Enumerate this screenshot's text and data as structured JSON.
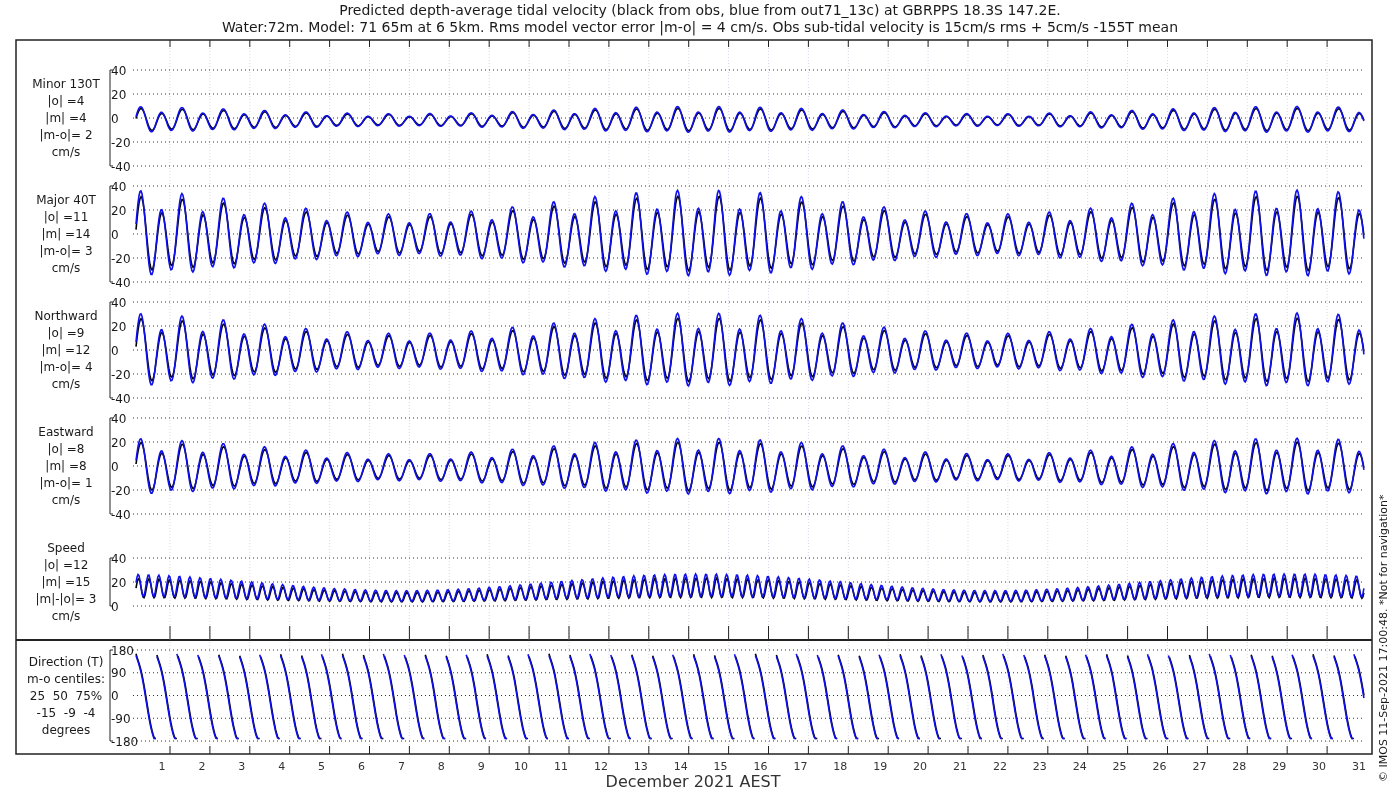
{
  "title": "Predicted depth-average tidal velocity (black from obs, blue from out71_13c) at GBRPPS 18.3S 147.2E.",
  "subtitle": "Water:72m. Model: 71 65m at 6 5km. Rms model vector error |m-o| = 4 cm/s. Obs sub-tidal velocity is 15cm/s rms + 5cm/s -155T mean",
  "panels": [
    {
      "kind": "velocity",
      "label": [
        "Minor 130T",
        "|o| =4",
        "|m| =4",
        "|m-o|= 2",
        "cm/s"
      ],
      "yticks": [
        "40",
        "20",
        "0",
        "-20",
        "-40"
      ]
    },
    {
      "kind": "velocity",
      "label": [
        "Major 40T",
        "|o| =11",
        "|m| =14",
        "|m-o|= 3",
        "cm/s"
      ],
      "yticks": [
        "40",
        "20",
        "0",
        "-20",
        "-40"
      ]
    },
    {
      "kind": "velocity",
      "label": [
        "Northward",
        "|o| =9",
        "|m| =12",
        "|m-o|= 4",
        "cm/s"
      ],
      "yticks": [
        "40",
        "20",
        "0",
        "-20",
        "-40"
      ]
    },
    {
      "kind": "velocity",
      "label": [
        "Eastward",
        "|o| =8",
        "|m| =8",
        "|m-o|= 1",
        "cm/s"
      ],
      "yticks": [
        "40",
        "20",
        "0",
        "-20",
        "-40"
      ]
    },
    {
      "kind": "speed",
      "label": [
        "Speed",
        "|o| =12",
        "|m| =15",
        "|m|-|o|= 3",
        "cm/s"
      ],
      "yticks": [
        "40",
        "20",
        "0"
      ]
    },
    {
      "kind": "direction",
      "label": [
        "Direction (T)",
        "m-o centiles:",
        "25  50  75%",
        "-15  -9  -4",
        "degrees"
      ],
      "yticks": [
        "180",
        "90",
        "0",
        "-90",
        "-180"
      ]
    }
  ],
  "xaxis": {
    "ticks": [
      "1",
      "2",
      "3",
      "4",
      "5",
      "6",
      "7",
      "8",
      "9",
      "10",
      "11",
      "12",
      "13",
      "14",
      "15",
      "16",
      "17",
      "18",
      "19",
      "20",
      "21",
      "22",
      "23",
      "24",
      "25",
      "26",
      "27",
      "28",
      "29",
      "30",
      "31"
    ],
    "label": "December 2021 AEST"
  },
  "credit": "© IMOS 11-Sep-2021 17:00:48. *Not for navigation*"
}
